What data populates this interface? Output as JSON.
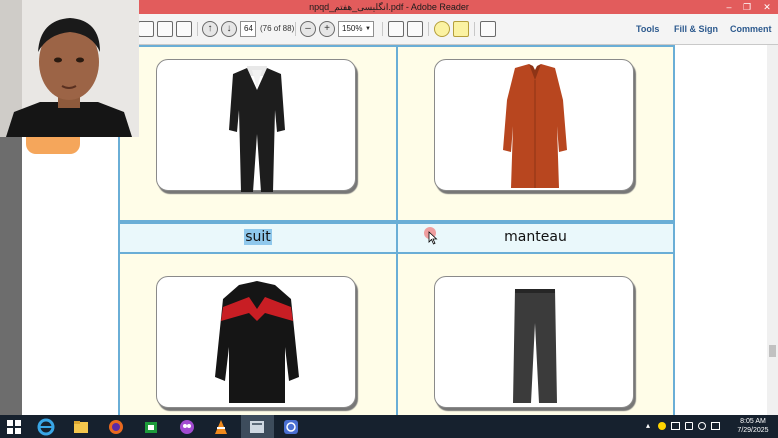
{
  "window": {
    "title": "npqd_انگلیسی_هفتم.pdf - Adobe Reader"
  },
  "toolbar": {
    "page_current": "64",
    "page_total": "(76 of 88)",
    "zoom": "150%",
    "links": [
      "Tools",
      "Fill & Sign",
      "Comment"
    ]
  },
  "document": {
    "labels": [
      "suit",
      "manteau"
    ],
    "items": [
      "suit",
      "manteau",
      "jacket",
      "trousers"
    ]
  },
  "taskbar": {
    "time": "8:05 AM",
    "date": "7/29/2025"
  },
  "icons": [
    "windows-start-icon",
    "ie-icon",
    "file-explorer-icon",
    "firefox-icon",
    "store-icon",
    "people-icon",
    "vlc-icon",
    "adobe-reader-icon",
    "app-icon"
  ]
}
